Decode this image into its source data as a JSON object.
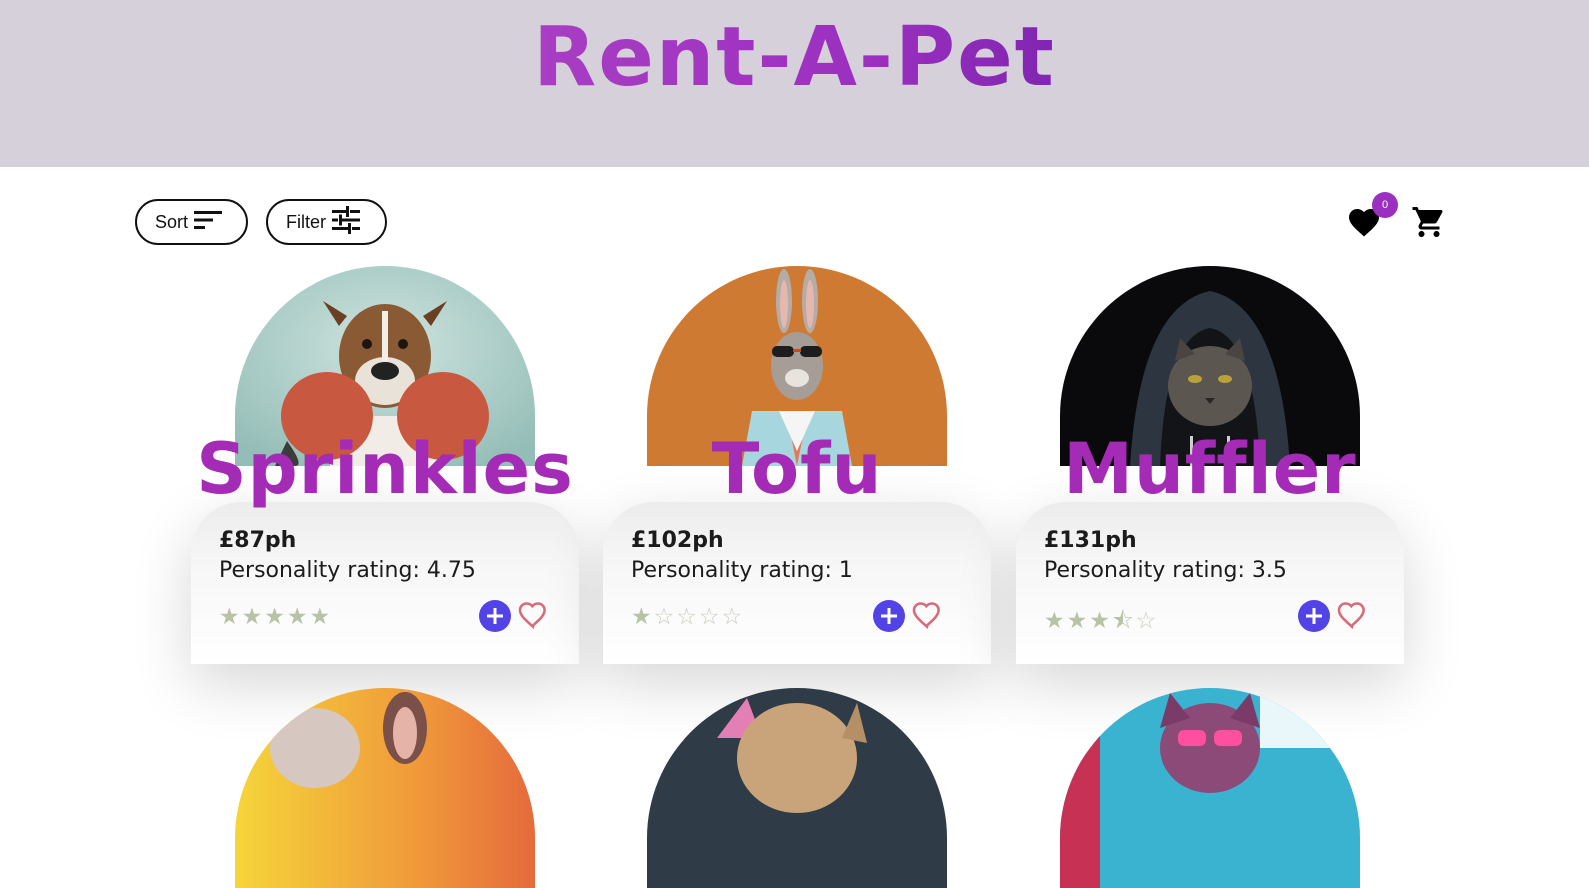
{
  "header": {
    "logo_text": "Rent-A-Pet",
    "bg_color": "#d5d0d9"
  },
  "toolbar": {
    "sort_label": "Sort",
    "sort_icon": "sort-lines-icon",
    "filter_label": "Filter",
    "filter_icon": "sliders-icon",
    "favorites_count": "0",
    "favorites_icon": "heart-icon",
    "cart_icon": "cart-icon"
  },
  "pets": [
    {
      "name": "Sprinkles",
      "price": "£87ph",
      "rating_text": "Personality rating: 4.75",
      "stars": 4.75,
      "image": "boxer dog with boxing gloves"
    },
    {
      "name": "Tofu",
      "price": "£102ph",
      "rating_text": "Personality rating: 1",
      "stars": 1,
      "image": "rabbit in suit with sunglasses"
    },
    {
      "name": "Muffler",
      "price": "£131ph",
      "rating_text": "Personality rating: 3.5",
      "stars": 3.5,
      "image": "cat in dark hoodie"
    }
  ],
  "colors": {
    "name": "#a32bb5",
    "add_button": "#5143e6",
    "heart_outline": "#d86a7a",
    "star": "#b7c3a4",
    "badge": "#9b30c0"
  }
}
